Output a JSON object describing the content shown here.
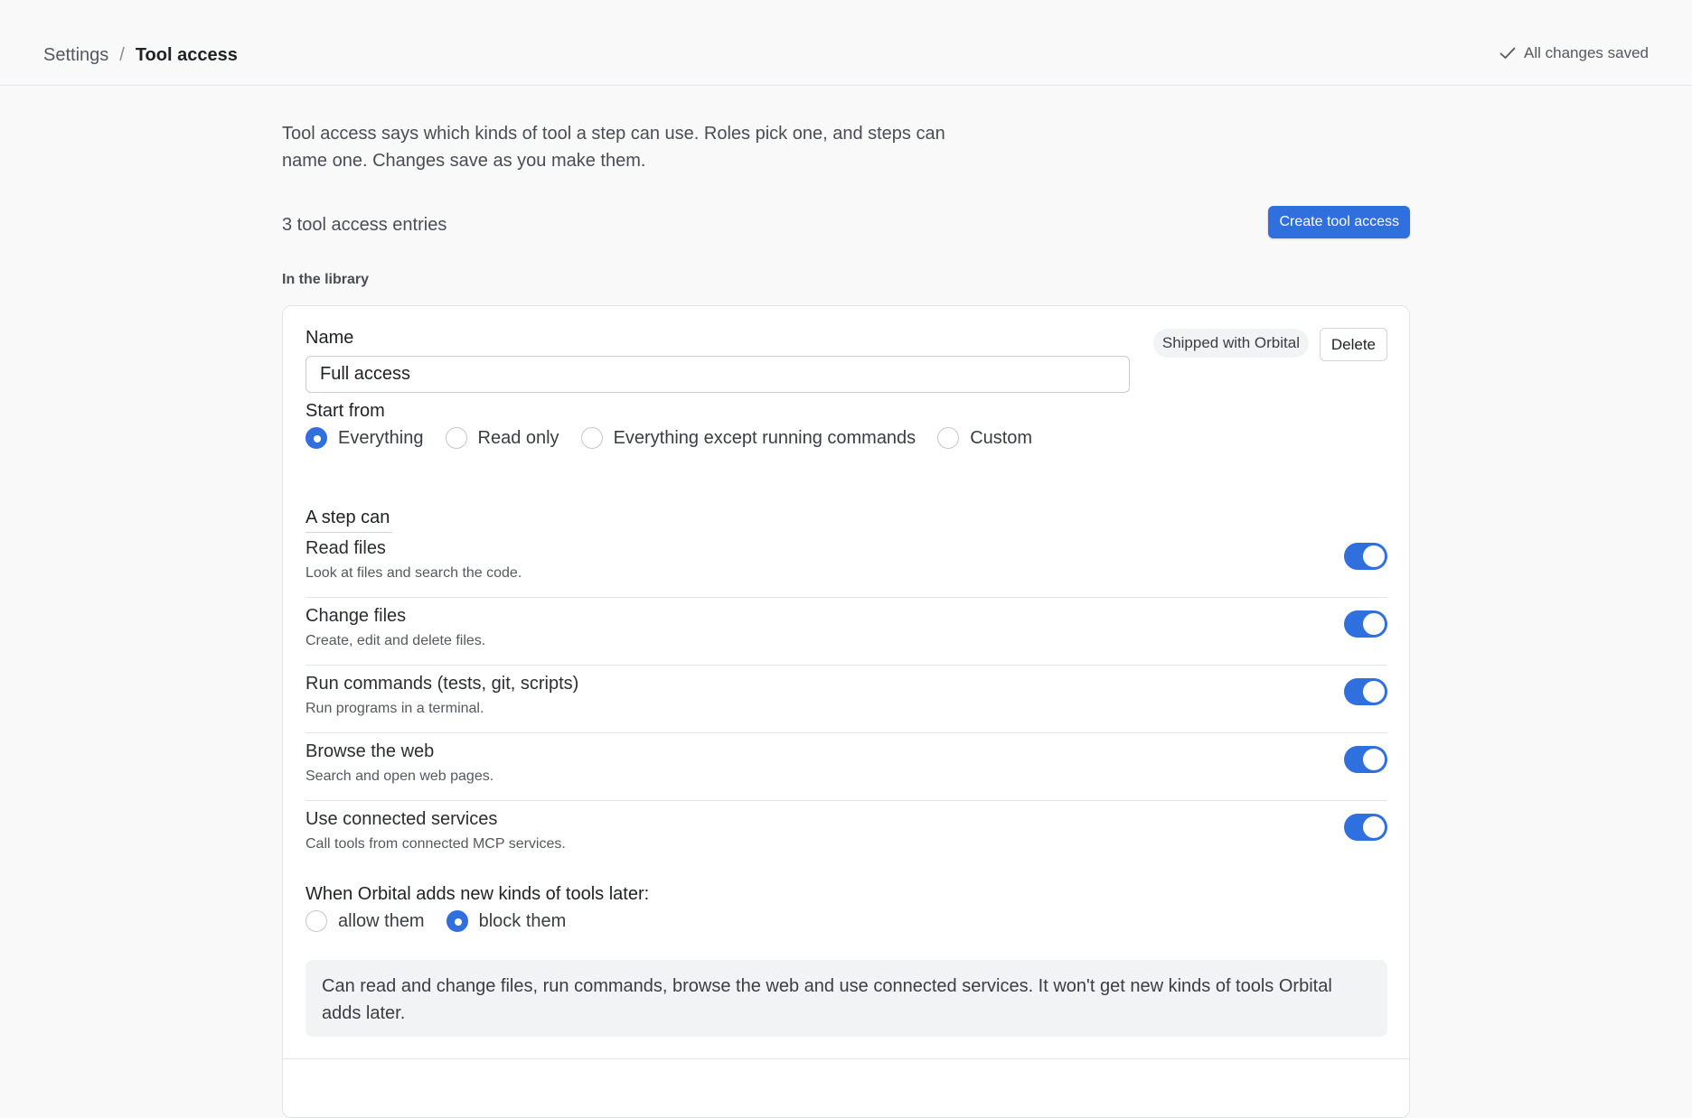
{
  "header": {
    "breadcrumb_root": "Settings",
    "breadcrumb_separator": "/",
    "breadcrumb_current": "Tool access",
    "save_status": "All changes saved"
  },
  "intro": {
    "text": "Tool access says which kinds of tool a step can use. Roles pick one, and steps can name one. Changes save as you make them."
  },
  "toolbar": {
    "entries_count": "3 tool access entries",
    "create_label": "Create tool access"
  },
  "library": {
    "section_label": "In the library",
    "entry": {
      "name_label": "Name",
      "name_value": "Full access",
      "badge": "Shipped with Orbital",
      "delete_label": "Delete",
      "start_from_label": "Start from",
      "start_options": [
        {
          "label": "Everything",
          "checked": true
        },
        {
          "label": "Read only",
          "checked": false
        },
        {
          "label": "Everything except running commands",
          "checked": false
        },
        {
          "label": "Custom",
          "checked": false
        }
      ],
      "step_can_label": "A step can",
      "permissions": [
        {
          "title": "Read files",
          "desc": "Look at files and search the code.",
          "enabled": true
        },
        {
          "title": "Change files",
          "desc": "Create, edit and delete files.",
          "enabled": true
        },
        {
          "title": "Run commands (tests, git, scripts)",
          "desc": "Run programs in a terminal.",
          "enabled": true
        },
        {
          "title": "Browse the web",
          "desc": "Search and open web pages.",
          "enabled": true
        },
        {
          "title": "Use connected services",
          "desc": "Call tools from connected MCP services.",
          "enabled": true
        }
      ],
      "new_tools_label": "When Orbital adds new kinds of tools later:",
      "new_tools_options": [
        {
          "label": "allow them",
          "checked": false
        },
        {
          "label": "block them",
          "checked": true
        }
      ],
      "summary": "Can read and change files, run commands, browse the web and use connected services. It won't get new kinds of tools Orbital adds later."
    }
  },
  "colors": {
    "accent": "#2f6fde",
    "background": "#f9f9fa",
    "card": "#ffffff",
    "border": "#e3e4e7"
  },
  "icons": {
    "save_status": "check-icon"
  }
}
